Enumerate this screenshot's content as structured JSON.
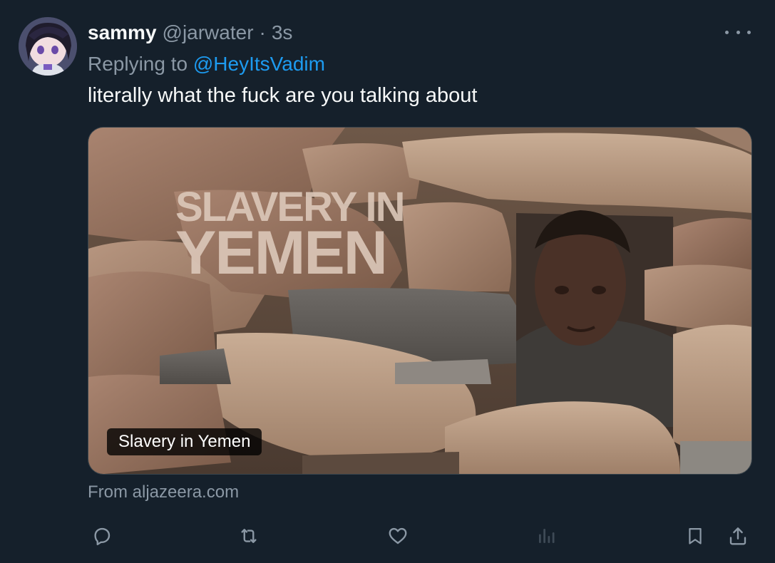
{
  "author": {
    "display_name": "sammy",
    "handle": "@jarwater",
    "separator": "·",
    "time": "3s"
  },
  "reply": {
    "prefix": "Replying to ",
    "to_handle": "@HeyItsVadim"
  },
  "tweet_text": "literally what the fuck are you talking about",
  "card": {
    "image_title_line1": "SLAVERY IN",
    "image_title_line2": "YEMEN",
    "caption": "Slavery in Yemen",
    "source": "From aljazeera.com"
  },
  "icons": {
    "more": "more-horizontal-icon",
    "reply": "reply-icon",
    "retweet": "retweet-icon",
    "like": "heart-icon",
    "views": "analytics-icon",
    "bookmark": "bookmark-icon",
    "share": "share-icon"
  },
  "colors": {
    "background": "#15202b",
    "primary_text": "#f7f9f9",
    "secondary_text": "#8b98a5",
    "link": "#1d9bf0",
    "views_icon": "#3e4a56"
  }
}
